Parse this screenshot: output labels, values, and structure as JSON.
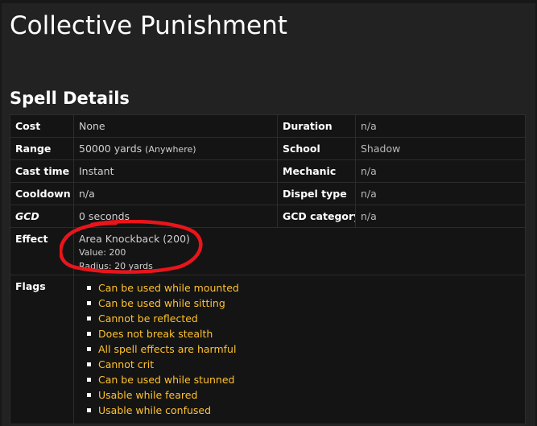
{
  "page": {
    "title": "Collective Punishment",
    "section_title": "Spell Details"
  },
  "details": {
    "cost_label": "Cost",
    "cost_value": "None",
    "duration_label": "Duration",
    "duration_value": "n/a",
    "range_label": "Range",
    "range_value": "50000 yards",
    "range_note": "(Anywhere)",
    "school_label": "School",
    "school_value": "Shadow",
    "cast_time_label": "Cast time",
    "cast_time_value": "Instant",
    "mechanic_label": "Mechanic",
    "mechanic_value": "n/a",
    "cooldown_label": "Cooldown",
    "cooldown_value": "n/a",
    "dispel_label": "Dispel type",
    "dispel_value": "n/a",
    "gcd_label": "GCD",
    "gcd_value": "0 seconds",
    "gcd_category_label": "GCD category",
    "gcd_category_value": "n/a"
  },
  "effect": {
    "label": "Effect",
    "name": "Area Knockback (200)",
    "value": "Value: 200",
    "radius": "Radius: 20 yards"
  },
  "flags": {
    "label": "Flags",
    "items": [
      "Can be used while mounted",
      "Can be used while sitting",
      "Cannot be reflected",
      "Does not break stealth",
      "All spell effects are harmful",
      "Cannot crit",
      "Can be used while stunned",
      "Usable while feared",
      "Usable while confused"
    ]
  },
  "colors": {
    "flag_text": "#ffc22e",
    "annotation": "#e8151b"
  }
}
